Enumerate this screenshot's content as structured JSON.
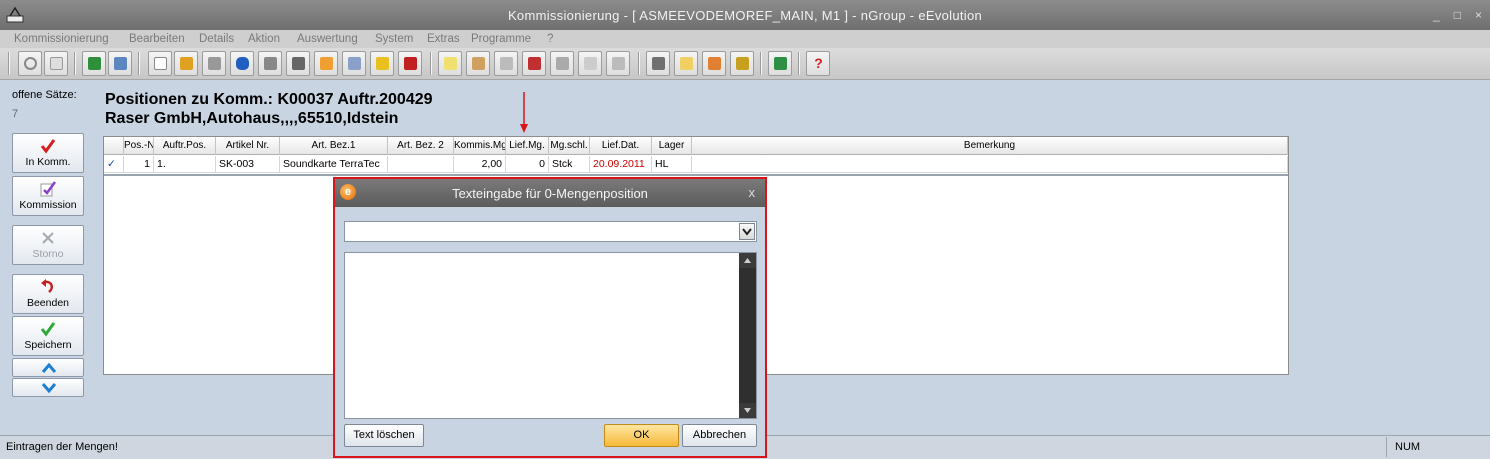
{
  "window": {
    "title": "Kommissionierung - [ ASMEEVODEMOREF_MAIN, M1 ]  -  nGroup - eEvolution",
    "buttons": [
      "_",
      "□",
      "×"
    ]
  },
  "menu": [
    "Kommissionierung",
    "Bearbeiten",
    "Details",
    "Aktion",
    "Auswertung",
    "System",
    "Extras",
    "Programme",
    "?"
  ],
  "toolbar_icons": [
    "search-icon",
    "find-icon",
    "excel-icon",
    "print-icon",
    "new-document-icon",
    "spellcheck-icon",
    "cup-icon",
    "database-icon",
    "teapot-icon",
    "keyboard-icon",
    "layers-icon",
    "tag-icon",
    "alert-icon",
    "undo-icon",
    "notepad-icon",
    "box-icon",
    "printer-gray-icon",
    "truck-icon",
    "settings-gray-icon",
    "export-gray-icon",
    "print-gray-icon",
    "calculator-icon",
    "document-edit-icon",
    "users-icon",
    "truck-yellow-icon",
    "exit-icon",
    "help-icon"
  ],
  "left_panel": {
    "open_label": "offene Sätze:",
    "open_count": "7",
    "buttons": [
      {
        "label": "In Komm.",
        "icon": "red-check-icon",
        "enabled": true
      },
      {
        "label": "Kommission",
        "icon": "note-check-icon",
        "enabled": true
      },
      {
        "label": "Storno",
        "icon": "cross-icon",
        "enabled": false
      },
      {
        "label": "Beenden",
        "icon": "undo-arrow-icon",
        "enabled": true
      },
      {
        "label": "Speichern",
        "icon": "green-check-icon",
        "enabled": true
      }
    ]
  },
  "heading": {
    "line1": "Positionen zu Komm.: K00037 Auftr.200429",
    "line2": "Raser GmbH,Autohaus,,,,65510,Idstein"
  },
  "grid": {
    "columns": [
      "Pos.-Nr",
      "Auftr.Pos.",
      "Artikel Nr.",
      "Art. Bez.1",
      "Art. Bez. 2",
      "Kommis.Mg",
      "Lief.Mg.",
      "Mg.schl.",
      "Lief.Dat.",
      "Lager",
      "Bemerkung"
    ],
    "rows": [
      {
        "check": "✓",
        "pos_nr": "1",
        "auftr_pos": "1.",
        "artikel_nr": "SK-003",
        "bez1": "Soundkarte TerraTec",
        "bez2": "",
        "kommis_mg": "2,00",
        "lief_mg": "0",
        "mg_schl": "Stck",
        "lief_dat": "20.09.2011",
        "lager": "HL",
        "bemerkung": ""
      }
    ],
    "date_color": "#cc0000"
  },
  "status": {
    "text": "Eintragen der Mengen!",
    "num": "NUM"
  },
  "dialog": {
    "title": "Texteingabe für 0-Mengenposition",
    "close": "x",
    "combo_value": "",
    "memo_value": "",
    "clear_label": "Text löschen",
    "ok_label": "OK",
    "cancel_label": "Abbrechen",
    "highlight_color": "#d9141b"
  }
}
